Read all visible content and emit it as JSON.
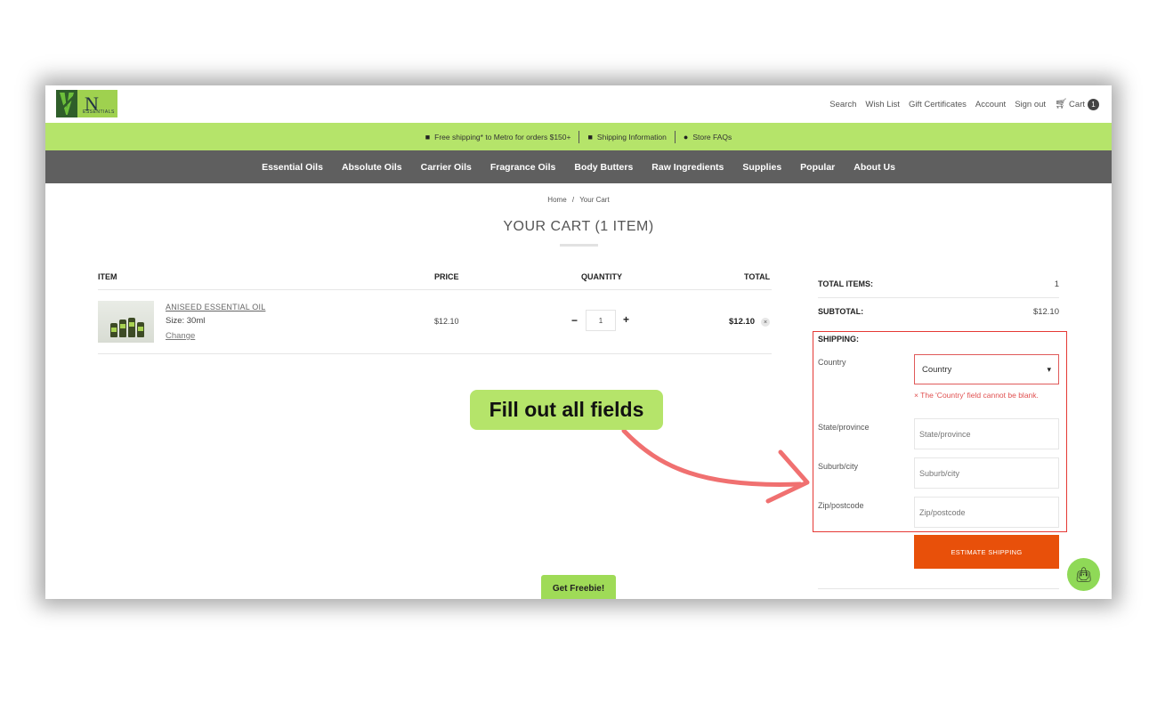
{
  "header": {
    "logo_text": "N",
    "logo_subtext": "ESSENTIALS",
    "links": [
      "Search",
      "Wish List",
      "Gift Certificates",
      "Account",
      "Sign out"
    ],
    "cart_label": "Cart",
    "cart_count": "1"
  },
  "promo": {
    "items": [
      "Free shipping* to Metro for orders $150+",
      "Shipping Information",
      "Store FAQs"
    ]
  },
  "nav": {
    "items": [
      "Essential Oils",
      "Absolute Oils",
      "Carrier Oils",
      "Fragrance Oils",
      "Body Butters",
      "Raw Ingredients",
      "Supplies",
      "Popular",
      "About Us"
    ]
  },
  "breadcrumb": {
    "home": "Home",
    "sep": "/",
    "current": "Your Cart"
  },
  "page_title": "YOUR CART (1 ITEM)",
  "table": {
    "headers": {
      "item": "ITEM",
      "price": "PRICE",
      "quantity": "QUANTITY",
      "total": "TOTAL"
    },
    "row": {
      "name": "ANISEED ESSENTIAL OIL",
      "size": "Size: 30ml",
      "change": "Change",
      "price": "$12.10",
      "qty": "1",
      "minus": "−",
      "plus": "+",
      "total": "$12.10",
      "remove": "×"
    }
  },
  "summary": {
    "total_items_label": "TOTAL ITEMS:",
    "total_items_value": "1",
    "subtotal_label": "SUBTOTAL:",
    "subtotal_value": "$12.10",
    "shipping_label": "SHIPPING:",
    "country_label": "Country",
    "country_value": "Country",
    "country_error": "× The 'Country' field cannot be blank.",
    "state_label": "State/province",
    "state_placeholder": "State/province",
    "city_label": "Suburb/city",
    "city_placeholder": "Suburb/city",
    "zip_label": "Zip/postcode",
    "zip_placeholder": "Zip/postcode",
    "estimate_button": "ESTIMATE SHIPPING"
  },
  "callout": "Fill out all fields",
  "freebie_button": "Get Freebie!",
  "colors": {
    "brand_green": "#b5e46a",
    "nav_gray": "#5f5f5f",
    "accent_orange": "#e8500a",
    "error_red": "#e53935",
    "arrow": "#f07070"
  }
}
